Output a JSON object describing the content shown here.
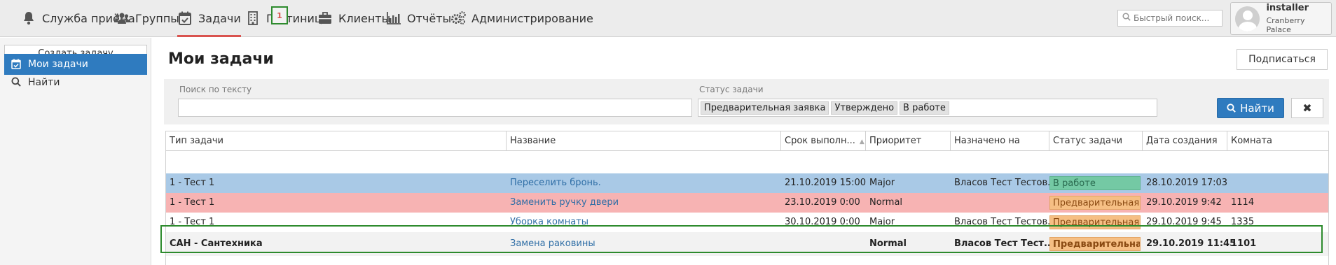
{
  "nav": {
    "items": [
      {
        "label": "Служба приёма",
        "icon": "bell-icon"
      },
      {
        "label": "Группы",
        "icon": "users-icon"
      },
      {
        "label": "Задачи",
        "icon": "calendar-check-icon"
      },
      {
        "label": "Гостиница",
        "icon": "building-icon"
      },
      {
        "label": "Клиенты",
        "icon": "briefcase-icon"
      },
      {
        "label": "Отчёты",
        "icon": "bar-chart-icon"
      },
      {
        "label": "Администрирование",
        "icon": "gears-icon"
      }
    ],
    "tasks_badge": "1",
    "search_placeholder": "Быстрый поиск...",
    "user": {
      "name": "installer",
      "hotel": "Cranberry Palace"
    }
  },
  "sidebar": {
    "create_label": "Создать задачу",
    "items": [
      {
        "label": "Мои задачи",
        "icon": "calendar-check-icon"
      },
      {
        "label": "Найти",
        "icon": "search-icon"
      }
    ]
  },
  "main": {
    "title": "Мои задачи",
    "subscribe_label": "Подписаться",
    "filters": {
      "text_label": "Поиск по тексту",
      "text_value": "",
      "status_label": "Статус задачи",
      "status_chips": [
        "Предварительная заявка",
        "Утверждено",
        "В работе"
      ],
      "find_label": "Найти",
      "clear_label": "✖"
    },
    "columns": [
      "Тип задачи",
      "Название",
      "Срок выполн...",
      "Приоритет",
      "Назначено на",
      "Статус задачи",
      "Дата создания",
      "Комната"
    ],
    "rows": [
      {
        "type": "1 - Тест 1",
        "name": "Переселить бронь.",
        "due": "21.10.2019 15:00",
        "priority": "Major",
        "assigned": "Власов Тест Тестов...",
        "status": "В работе",
        "created": "28.10.2019 17:03",
        "room": ""
      },
      {
        "type": "1 - Тест 1",
        "name": "Заменить ручку двери",
        "due": "23.10.2019 0:00",
        "priority": "Normal",
        "assigned": "",
        "status": "Предварительная з",
        "created": "29.10.2019 9:42",
        "room": "1114"
      },
      {
        "type": "1 - Тест 1",
        "name": "Уборка комнаты",
        "due": "30.10.2019 0:00",
        "priority": "Major",
        "assigned": "Власов Тест Тестов...",
        "status": "Предварительная з",
        "created": "29.10.2019 9:45",
        "room": "1335"
      },
      {
        "type": "САН - Сантехника",
        "name": "Замена раковины",
        "due": "",
        "priority": "Normal",
        "assigned": "Власов Тест Тест...",
        "status": "Предварительная з",
        "created": "29.10.2019 11:45",
        "room": "1101"
      }
    ]
  },
  "colors": {
    "accent_blue": "#2f7bbf",
    "row_selected": "#a9c9e6",
    "row_overdue": "#f7b3b3",
    "row_new": "#f2f2f2",
    "status_in_work": "#74c9a4",
    "status_preliminary": "#f6bf84",
    "highlight_frame": "#2e8b2e",
    "active_tab": "#d9534f"
  }
}
